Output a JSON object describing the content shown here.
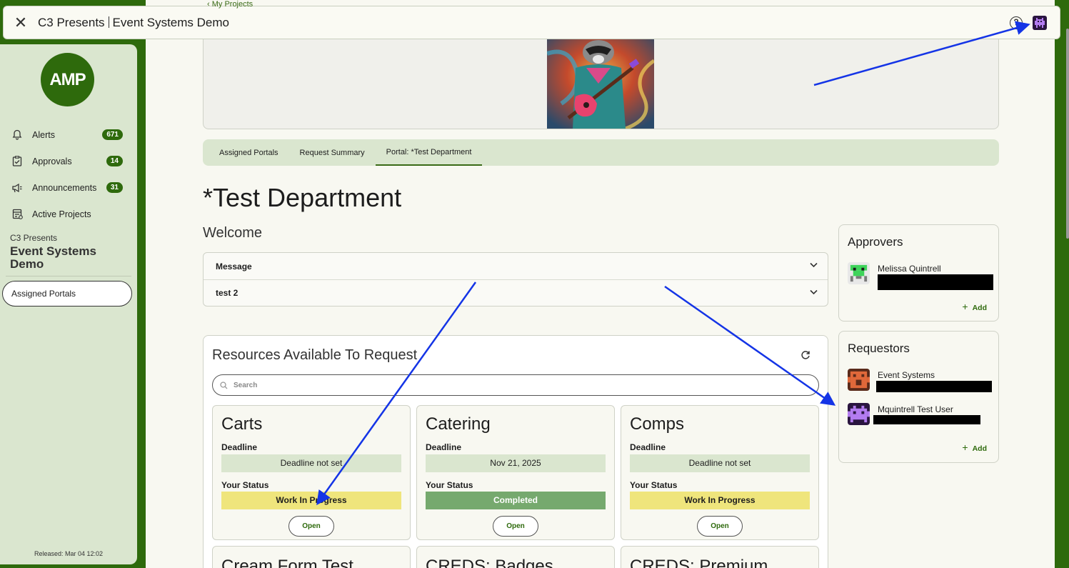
{
  "topbar": {
    "close_icon": "close-icon",
    "title_left": "C3 Presents",
    "title_right": "Event Systems Demo",
    "help_icon": "help-circle-icon",
    "help_glyph": "?",
    "avatar_icon": "purple-pixel-avatar-icon"
  },
  "breadcrumb": {
    "text": "‹  My Projects"
  },
  "sidebar": {
    "logo_text": "AMP",
    "items": [
      {
        "label": "Alerts",
        "icon": "bell-icon",
        "badge": "671"
      },
      {
        "label": "Approvals",
        "icon": "clipboard-check-icon",
        "badge": "14"
      },
      {
        "label": "Announcements",
        "icon": "megaphone-icon",
        "badge": "31"
      },
      {
        "label": "Active Projects",
        "icon": "project-list-icon",
        "badge": ""
      }
    ],
    "project_sub": "C3 Presents",
    "project_title": "Event Systems Demo",
    "assigned_portals": "Assigned Portals",
    "released": "Released: Mar 04 12:02"
  },
  "tabs": [
    {
      "label": "Assigned Portals",
      "active": false
    },
    {
      "label": "Request Summary",
      "active": false
    },
    {
      "label": "Portal: *Test Department",
      "active": true
    }
  ],
  "page": {
    "title": "*Test Department",
    "welcome": "Welcome"
  },
  "accordion": [
    {
      "label": "Message"
    },
    {
      "label": "test 2"
    }
  ],
  "resources": {
    "title": "Resources Available To Request",
    "search_placeholder": "Search",
    "deadline_label": "Deadline",
    "status_label": "Your Status",
    "open_label": "Open",
    "cards": [
      {
        "name": "Carts",
        "deadline": "Deadline not set",
        "status": "Work In Progress",
        "status_type": "wip"
      },
      {
        "name": "Catering",
        "deadline": "Nov 21, 2025",
        "status": "Completed",
        "status_type": "done"
      },
      {
        "name": "Comps",
        "deadline": "Deadline not set",
        "status": "Work In Progress",
        "status_type": "wip"
      }
    ],
    "cards_row2": [
      {
        "name": "Cream Form Test"
      },
      {
        "name": "CREDS: Badges"
      },
      {
        "name": "CREDS: Premium"
      }
    ]
  },
  "approvers": {
    "title": "Approvers",
    "people": [
      {
        "name": "Melissa Quintrell",
        "avatar": "green-pixel-avatar-icon"
      }
    ],
    "add_label": "Add"
  },
  "requestors": {
    "title": "Requestors",
    "people": [
      {
        "name": "Event Systems",
        "avatar": "orange-pixel-avatar-icon"
      },
      {
        "name": "Mquintrell Test User",
        "avatar": "purple-pixel-avatar-icon"
      }
    ],
    "add_label": "Add"
  },
  "colors": {
    "brand_green": "#2e6a0c",
    "sidebar_bg": "#dae6cf",
    "wip": "#efe57c",
    "completed": "#76a96e",
    "annotation_arrow": "#1434e6"
  }
}
